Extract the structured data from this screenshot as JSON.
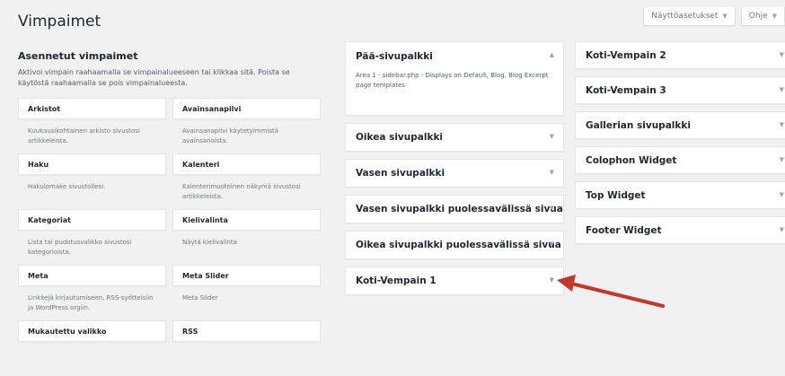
{
  "screen_meta": {
    "options_label": "Näyttöasetukset",
    "help_label": "Ohje"
  },
  "page_title": "Vimpaimet",
  "available": {
    "heading": "Asennetut vimpaimet",
    "description": "Aktivoi vimpain raahaamalla se vimpainalueeseen tai klikkaa sitä. Poista se käytöstä raahaamalla se pois vimpainalueesta.",
    "widgets": [
      {
        "title": "Arkistot",
        "desc": "Kuukausikohtainen arkisto sivustosi artikkeleista."
      },
      {
        "title": "Avainsanapilvi",
        "desc": "Avainsanapilvi käytetyimmistä avainsanoista."
      },
      {
        "title": "Haku",
        "desc": "Hakulomake sivustollesi."
      },
      {
        "title": "Kalenteri",
        "desc": "Kalenterimuotoinen näkymä sivustosi artikkeleista."
      },
      {
        "title": "Kategoriat",
        "desc": "Lista tai pudotusvalikko sivustosi kategorioista."
      },
      {
        "title": "Kielivalinta",
        "desc": "Näytä kielivalinta"
      },
      {
        "title": "Meta",
        "desc": "Linkkejä kirjautumiseen, RSS-syötteisiin ja WordPress.orgiin."
      },
      {
        "title": "Meta Slider",
        "desc": "Meta Slider"
      },
      {
        "title": "Mukautettu valikko",
        "desc": ""
      },
      {
        "title": "RSS",
        "desc": ""
      }
    ]
  },
  "sidebars_col2": [
    {
      "name": "Pää-sivupalkki",
      "open": true,
      "desc": "Area 1 - sidebar.php - Displays on Default, Blog, Blog Excerpt page templates"
    },
    {
      "name": "Oikea sivupalkki"
    },
    {
      "name": "Vasen sivupalkki"
    },
    {
      "name": "Vasen sivupalkki puolessavälissä sivua"
    },
    {
      "name": "Oikea sivupalkki puolessavälissä sivua"
    },
    {
      "name": "Koti-Vempain 1"
    }
  ],
  "sidebars_col3": [
    {
      "name": "Koti-Vempain 2"
    },
    {
      "name": "Koti-Vempain 3"
    },
    {
      "name": "Gallerian sivupalkki"
    },
    {
      "name": "Colophon Widget"
    },
    {
      "name": "Top Widget"
    },
    {
      "name": "Footer Widget"
    }
  ],
  "colors": {
    "background": "#f1f1f1",
    "annotation_arrow": "#c0392b"
  },
  "icons": {
    "collapse_arrow": "triangle-up-icon",
    "expand_arrow": "triangle-down-icon"
  }
}
